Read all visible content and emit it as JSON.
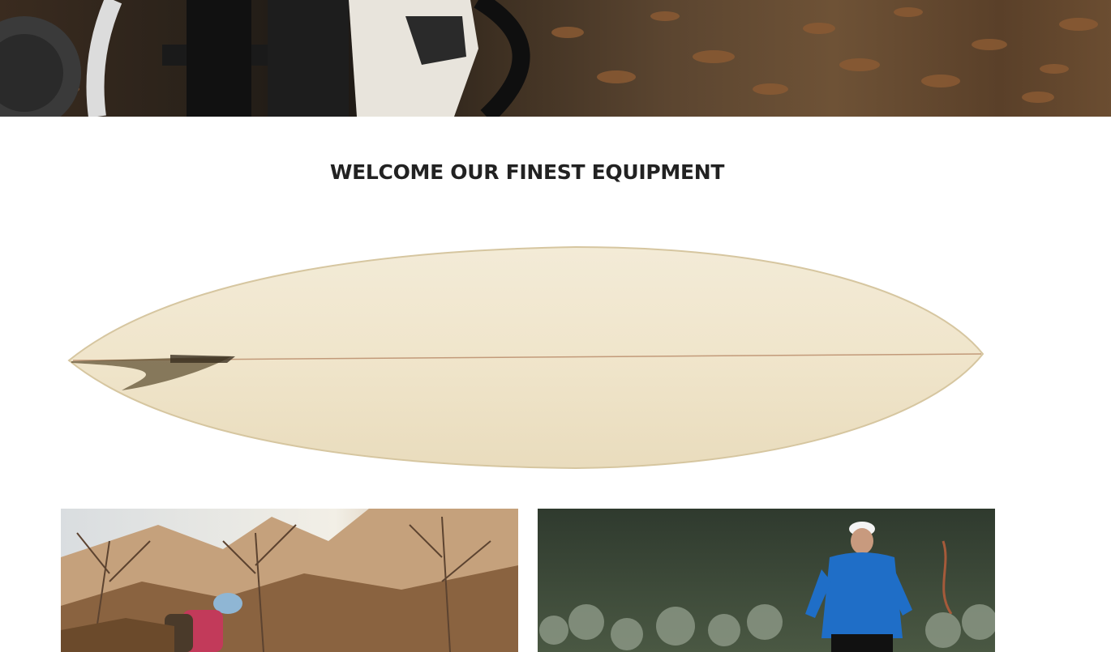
{
  "hero": {
    "image": "mountain-bike-detail-photo"
  },
  "section": {
    "heading": "WELCOME OUR FINEST EQUIPMENT"
  },
  "featured": {
    "image": "surfboard-photo"
  },
  "gallery": [
    {
      "image": "hiker-photo"
    },
    {
      "image": "trail-runner-photo"
    }
  ],
  "colors": {
    "heading": "#222222",
    "background": "#ffffff"
  }
}
